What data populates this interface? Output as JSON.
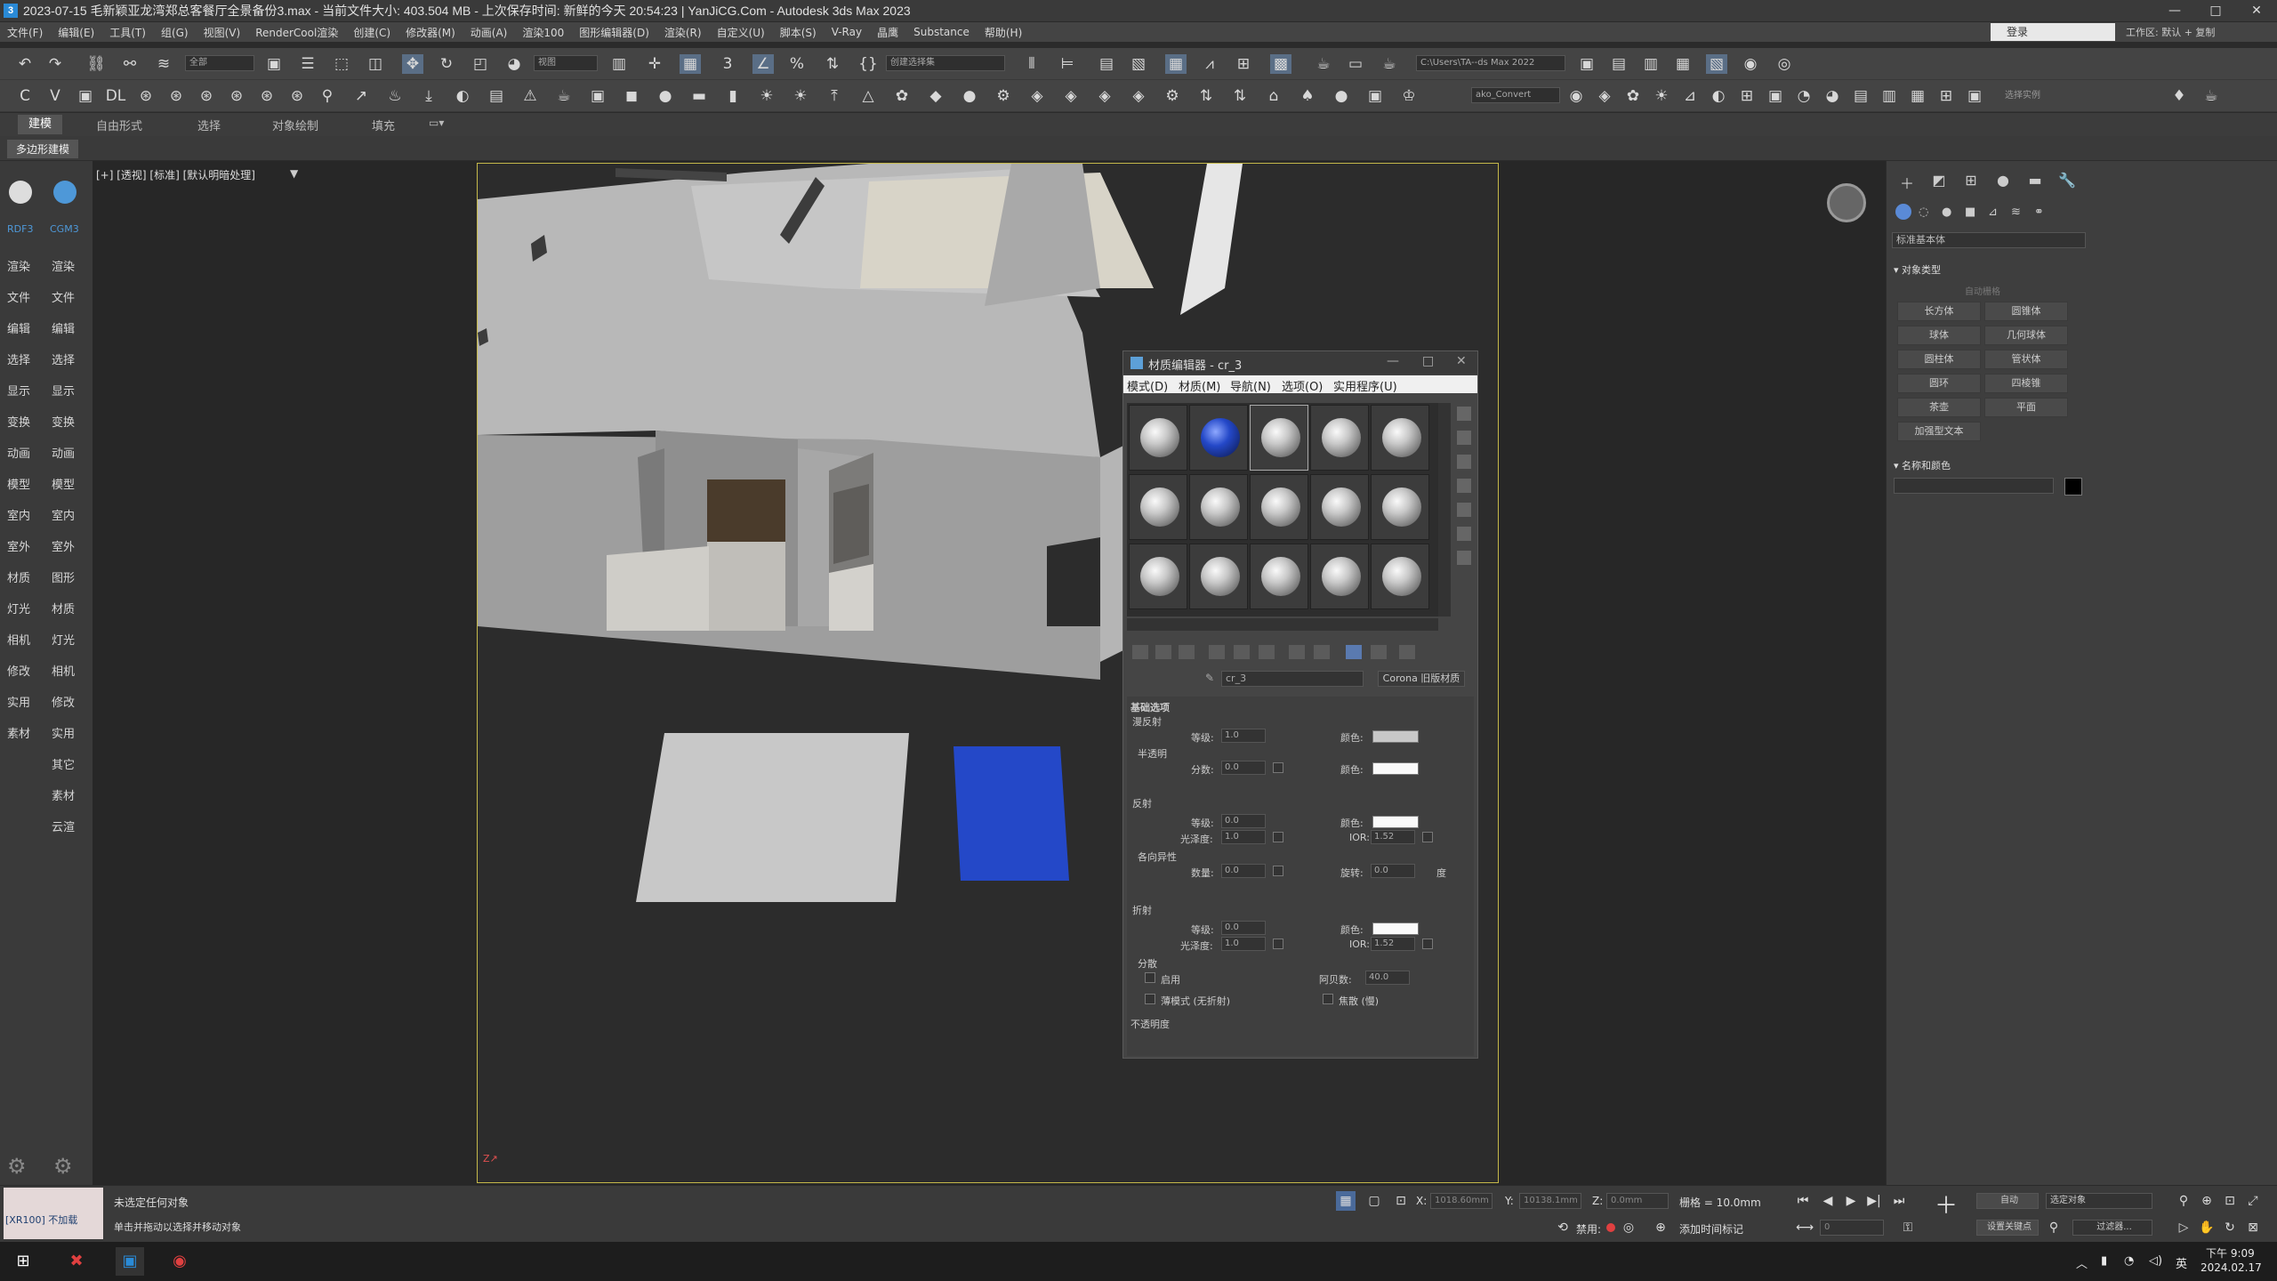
{
  "window": {
    "title": "2023-07-15 毛新颖亚龙湾郑总客餐厅全景备份3.max - 当前文件大小: 403.504 MB - 上次保存时间: 新鲜的今天 20:54:23 | YanJiCG.Com - Autodesk 3ds Max 2023",
    "min": "—",
    "max": "□",
    "close": "✕"
  },
  "menu": {
    "items": [
      "文件(F)",
      "编辑(E)",
      "工具(T)",
      "组(G)",
      "视图(V)",
      "RenderCool渲染",
      "创建(C)",
      "修改器(M)",
      "动画(A)",
      "渲染100",
      "图形编辑器(D)",
      "渲染(R)",
      "自定义(U)",
      "脚本(S)",
      "V-Ray",
      "晶鹰",
      "Substance",
      "帮助(H)"
    ],
    "login": "登录",
    "workspace_label": "工作区:",
    "workspace_value": "默认 + 复制"
  },
  "toolbar": {
    "filter_select": "全部",
    "refcoord_select": "视图",
    "named_selset": "创建选择集",
    "path_field": "C:\\Users\\TA--ds Max 2022",
    "convert_label": "ako_Convert",
    "select_instance": "选择实例"
  },
  "ribbon": {
    "tabs": [
      "建模",
      "自由形式",
      "选择",
      "对象绘制",
      "填充"
    ],
    "active": "建模",
    "sub": "多边形建模"
  },
  "leftbar": {
    "badges": [
      "RDF3",
      "CGM3"
    ],
    "col1": [
      "渲染",
      "文件",
      "编辑",
      "选择",
      "显示",
      "变换",
      "动画",
      "模型",
      "室内",
      "室外",
      "材质",
      "灯光",
      "相机",
      "修改",
      "实用",
      "素材"
    ],
    "col2": [
      "渲染",
      "文件",
      "编辑",
      "选择",
      "显示",
      "变换",
      "动画",
      "模型",
      "室内",
      "室外",
      "图形",
      "材质",
      "灯光",
      "相机",
      "修改",
      "实用",
      "其它",
      "素材",
      "云渲"
    ]
  },
  "viewport": {
    "label": "[+] [透视] [标准] [默认明暗处理]"
  },
  "material_editor": {
    "title": "材质编辑器 - cr_3",
    "menu": [
      "模式(D)",
      "材质(M)",
      "导航(N)",
      "选项(O)",
      "实用程序(U)"
    ],
    "material_name": "cr_3",
    "material_type": "Corona 旧版材质",
    "params": {
      "section": "基础选项",
      "diffuse": "漫反射",
      "level_label": "等级:",
      "diffuse_level": "1.0",
      "color_label": "颜色:",
      "translucency": "半透明",
      "fraction_label": "分数:",
      "trans_fraction": "0.0",
      "reflection": "反射",
      "refl_level": "0.0",
      "gloss_label": "光泽度:",
      "refl_gloss": "1.0",
      "ior_label": "IOR:",
      "refl_ior": "1.52",
      "aniso": "各向异性",
      "amount_label": "数量:",
      "aniso_amount": "0.0",
      "rotation_label": "旋转:",
      "aniso_rot": "0.0",
      "deg": "度",
      "refraction": "折射",
      "refr_level": "0.0",
      "refr_gloss": "1.0",
      "refr_ior": "1.52",
      "dispersion": "分散",
      "enable": "启用",
      "abbe_label": "阿贝数:",
      "abbe": "40.0",
      "thin": "薄模式 (无折射)",
      "caustics": "焦散 (慢)",
      "opacity": "不透明度"
    }
  },
  "rightpanel": {
    "dropdown": "标准基本体",
    "object_type": "对象类型",
    "autogrid": "自动栅格",
    "buttons": [
      "长方体",
      "圆锥体",
      "球体",
      "几何球体",
      "圆柱体",
      "管状体",
      "圆环",
      "四棱锥",
      "茶壶",
      "平面",
      "加强型文本"
    ],
    "name_color": "名称和颜色"
  },
  "status": {
    "maxscript": "[XR100]  不加载",
    "line1": "未选定任何对象",
    "line2": "单击并拖动以选择并移动对象",
    "x_label": "X:",
    "x_val": "1018.60mm",
    "y_label": "Y:",
    "y_val": "10138.1mm",
    "z_label": "Z:",
    "z_val": "0.0mm",
    "grid": "栅格 = 10.0mm",
    "disabled": "禁用:",
    "add_time_tag": "添加时间标记",
    "auto": "自动",
    "selected_obj": "选定对象",
    "set_key": "设置关键点",
    "filter": "过滤器...",
    "frame": "0"
  },
  "taskbar": {
    "lang": "英",
    "time": "下午 9:09",
    "date": "2024.02.17"
  },
  "colors": {
    "accent_blue": "#2a8ad6",
    "viewport_border": "#c5b84a",
    "blue_material": "#2448c8"
  }
}
